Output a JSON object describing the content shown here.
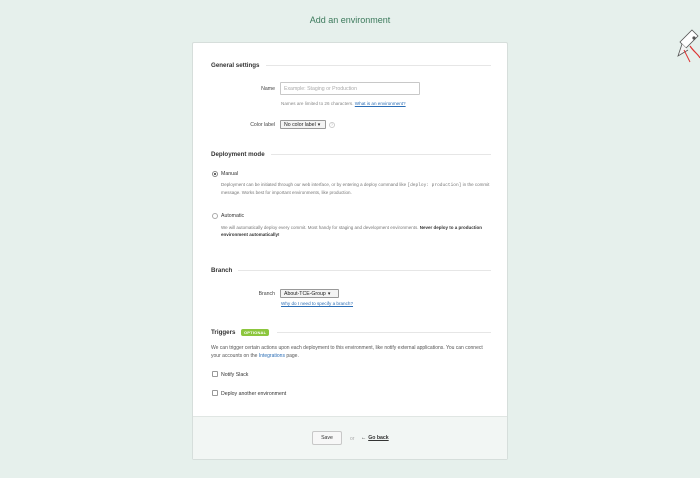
{
  "page": {
    "title": "Add an environment"
  },
  "general": {
    "title": "General settings",
    "name_label": "Name",
    "name_placeholder": "Example: Staging or Production",
    "name_hint_prefix": "Names are limited to 26 characters.",
    "name_hint_link": "What is an environment?",
    "color_label": "Color label",
    "color_selected": "No color label",
    "help_glyph": "?"
  },
  "deployment": {
    "title": "Deployment mode",
    "manual": {
      "label": "Manual",
      "checked": true,
      "desc_1": "Deployment can be initiated through our web interface, or by entering a deploy command like",
      "desc_code": "[deploy: production]",
      "desc_2": "in the commit message. Works best for important environments, like production."
    },
    "automatic": {
      "label": "Automatic",
      "checked": false,
      "desc_1": "We will automatically deploy every commit. Most handy for staging and development environments.",
      "desc_bold": "Never deploy to a production environment automatically!"
    }
  },
  "branch": {
    "title": "Branch",
    "label": "Branch",
    "selected": "About-TCE-Group",
    "help_link": "Why do I need to specify a branch?"
  },
  "triggers": {
    "title": "Triggers",
    "badge": "OPTIONAL",
    "desc_1": "We can trigger certain actions upon each deployment to this environment, like notify external applications. You can connect your accounts on the",
    "desc_link": "Integrations",
    "desc_2": "page.",
    "options": [
      {
        "label": "Notify Slack",
        "checked": false
      },
      {
        "label": "Deploy another environment",
        "checked": false
      }
    ]
  },
  "footer": {
    "save_label": "Save",
    "or_label": "or",
    "back_arrow": "←",
    "back_label": "Go back"
  },
  "colors": {
    "accent": "#3c7a5c",
    "background": "#e6f0ec",
    "badge": "#8cc63e",
    "link": "#2a6db5"
  }
}
